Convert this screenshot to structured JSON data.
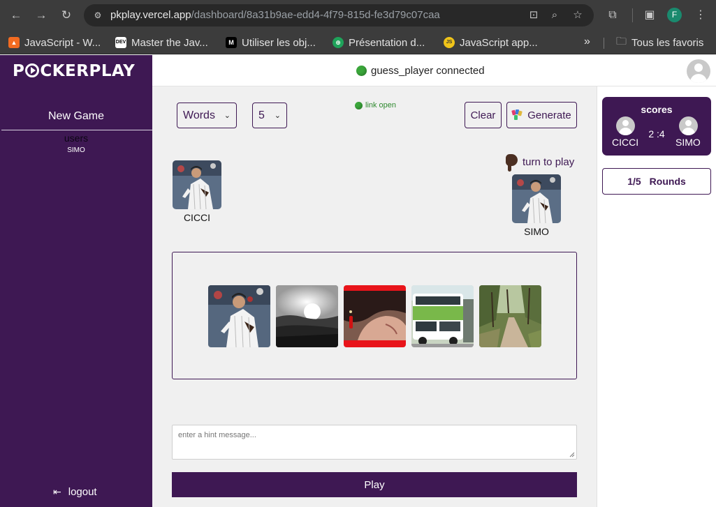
{
  "browser": {
    "url_host": "pkplay.vercel.app",
    "url_path": "/dashboard/8a31b9ae-edd4-4f79-815d-fe3d79c07caa",
    "profile_initial": "F",
    "bookmarks": [
      {
        "label": "JavaScript - W...",
        "icon": "mdn-icon"
      },
      {
        "label": "Master the Jav...",
        "icon": "dev-icon"
      },
      {
        "label": "Utiliser les obj...",
        "icon": "medium-icon"
      },
      {
        "label": "Présentation d...",
        "icon": "globe-icon"
      },
      {
        "label": "JavaScript app...",
        "icon": "js-icon"
      }
    ],
    "all_bookmarks": "Tous les favoris",
    "more": "»"
  },
  "sidebar": {
    "logo_left": "P",
    "logo_right": "CKERPLAY",
    "new_game": "New Game",
    "users_label": "users",
    "users": [
      "SIMO"
    ],
    "logout": "logout"
  },
  "header": {
    "status": "guess_player connected"
  },
  "controls": {
    "mode_select": "Words",
    "count_select": "5",
    "link_status": "link open",
    "clear": "Clear",
    "generate": "Generate"
  },
  "players": {
    "left": {
      "name": "CICCI"
    },
    "right": {
      "name": "SIMO"
    },
    "turn_label": "turn to play",
    "turn_holder": "SIMO"
  },
  "cards": [
    {
      "name": "card-baseball-pitcher",
      "selected": false
    },
    {
      "name": "card-sunset-field",
      "selected": false
    },
    {
      "name": "card-woman-portrait",
      "selected": true
    },
    {
      "name": "card-double-decker-bus",
      "selected": false
    },
    {
      "name": "card-forest-path",
      "selected": false
    }
  ],
  "hint": {
    "placeholder": "enter a hint message..."
  },
  "play": "Play",
  "scores": {
    "title": "scores",
    "left_name": "CICCI",
    "right_name": "SIMO",
    "value": "2 :4",
    "left_score": 2,
    "right_score": 4
  },
  "rounds": {
    "fraction": "1/5",
    "label": "Rounds"
  },
  "colors": {
    "brand": "#3e1853",
    "selected_card": "#e8141a",
    "online": "#3aa63a"
  }
}
